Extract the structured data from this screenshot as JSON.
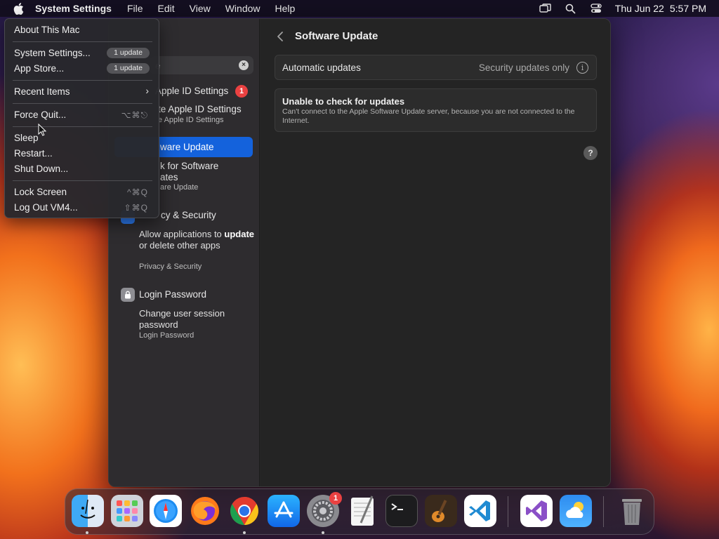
{
  "menubar": {
    "app_name": "System Settings",
    "menus": [
      "File",
      "Edit",
      "View",
      "Window",
      "Help"
    ],
    "clock_day": "Thu Jun 22",
    "clock_time": "5:57 PM"
  },
  "apple_menu": {
    "about": "About This Mac",
    "system_settings": "System Settings...",
    "system_settings_badge": "1 update",
    "app_store": "App Store...",
    "app_store_badge": "1 update",
    "recent_items": "Recent Items",
    "force_quit": "Force Quit...",
    "force_quit_shortcut": "⌥⌘⎋",
    "sleep": "Sleep",
    "restart": "Restart...",
    "shut_down": "Shut Down...",
    "lock_screen": "Lock Screen",
    "lock_screen_shortcut": "^⌘Q",
    "log_out": "Log Out VM4...",
    "log_out_shortcut": "⇧⌘Q"
  },
  "sidebar": {
    "search_value": "e",
    "apple_id": {
      "title": "Apple ID Settings",
      "badge": "1",
      "subtitle": "te Apple ID Settings",
      "category": "e Apple ID Settings"
    },
    "software_update": {
      "title": "ware Update",
      "subtitle_line1": "k for Software",
      "subtitle_line2": "ates",
      "category": "are Update"
    },
    "privacy": {
      "title": "cy & Security",
      "subtitle_pre": "Allow applications to",
      "subtitle_bold": "update",
      "subtitle_post": "or delete other apps",
      "category": "Privacy & Security"
    },
    "login_password": {
      "title": "Login Password",
      "subtitle": "Change user session password",
      "category": "Login Password"
    }
  },
  "main": {
    "title": "Software Update",
    "automatic_updates_label": "Automatic updates",
    "automatic_updates_value": "Security updates only",
    "error_title": "Unable to check for updates",
    "error_detail": "Can't connect to the Apple Software Update server, because you are not connected to the Internet.",
    "help": "?"
  },
  "dock": {
    "apps": [
      "Finder",
      "Launchpad",
      "Safari",
      "Firefox",
      "Chrome",
      "App Store",
      "System Settings",
      "TextEdit",
      "Terminal",
      "GarageBand",
      "Visual Studio Code",
      "Visual Studio",
      "Weather",
      "Trash"
    ],
    "system_settings_badge": "1"
  },
  "colors": {
    "accent": "#1462dc",
    "badge_red": "#ea4141"
  }
}
